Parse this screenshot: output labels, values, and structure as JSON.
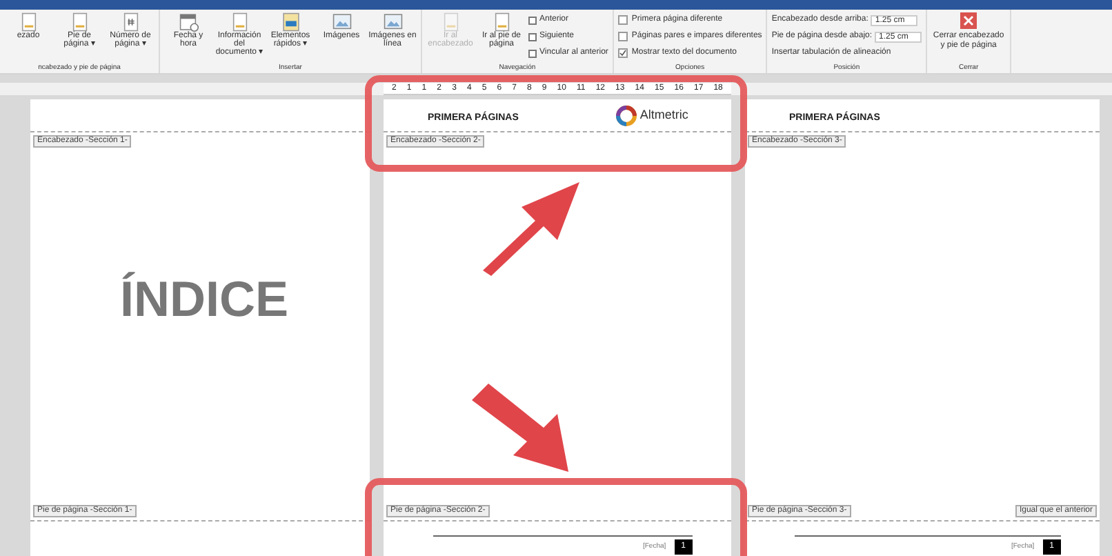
{
  "ribbon": {
    "groups": [
      {
        "label": "ncabezado y pie de página",
        "buttons": [
          {
            "label": "ezado",
            "kind": "page",
            "disabled": false
          },
          {
            "label": "Pie de página ▾",
            "kind": "page",
            "disabled": false
          },
          {
            "label": "Número de página ▾",
            "kind": "hash",
            "disabled": false
          }
        ]
      },
      {
        "label": "Insertar",
        "buttons": [
          {
            "label": "Fecha y hora",
            "kind": "calendar",
            "disabled": false
          },
          {
            "label": "Información del documento ▾",
            "kind": "page",
            "disabled": false
          },
          {
            "label": "Elementos rápidos ▾",
            "kind": "blocks",
            "disabled": false
          },
          {
            "label": "Imágenes",
            "kind": "image",
            "disabled": false
          },
          {
            "label": "Imágenes en línea",
            "kind": "image",
            "disabled": false
          }
        ]
      },
      {
        "label": "Navegación",
        "buttons": [
          {
            "label": "Ir al encabezado",
            "kind": "page",
            "disabled": true
          },
          {
            "label": "Ir al pie de página",
            "kind": "page",
            "disabled": false
          }
        ],
        "small": [
          "Anterior",
          "Siguiente",
          "Vincular al anterior"
        ]
      }
    ],
    "options": {
      "label": "Opciones",
      "items": [
        {
          "label": "Primera página diferente",
          "checked": false
        },
        {
          "label": "Páginas pares e impares diferentes",
          "checked": false
        },
        {
          "label": "Mostrar texto del documento",
          "checked": true
        }
      ]
    },
    "position": {
      "label": "Posición",
      "fields": [
        {
          "label": "Encabezado desde arriba:",
          "value": "1.25 cm"
        },
        {
          "label": "Pie de página desde abajo:",
          "value": "1.25 cm"
        }
      ],
      "insert_tab": "Insertar tabulación de alineación"
    },
    "close": {
      "label": "Cerrar",
      "button": "Cerrar encabezado y pie de página"
    }
  },
  "ruler": [
    "2",
    "1",
    "1",
    "2",
    "3",
    "4",
    "5",
    "6",
    "7",
    "8",
    "9",
    "10",
    "11",
    "12",
    "13",
    "14",
    "15",
    "16",
    "17",
    "18"
  ],
  "pages": [
    {
      "header_tag": "Encabezado -Sección 1-",
      "body_title": "ÍNDICE",
      "footer_tag": "Pie de página -Sección 1-"
    },
    {
      "header_text": "PRIMERA PÁGINAS",
      "logo_text": "Altmetric",
      "header_tag": "Encabezado -Sección 2-",
      "footer_tag": "Pie de página -Sección 2-",
      "page_field": "[Fecha]",
      "page_number": "1"
    },
    {
      "header_text": "PRIMERA PÁGINAS",
      "header_tag": "Encabezado -Sección 3-",
      "footer_tag": "Pie de página -Sección 3-",
      "footer_right": "Igual que el anterior",
      "page_field": "[Fecha]",
      "page_number": "1"
    }
  ]
}
